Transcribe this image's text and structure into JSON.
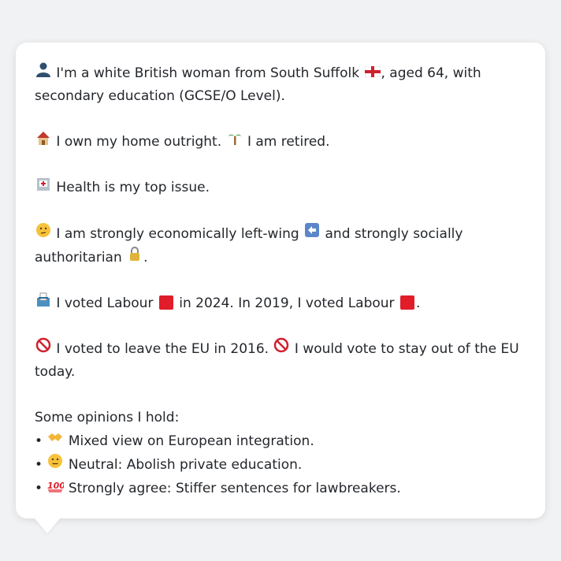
{
  "profile": {
    "identity": {
      "icon": "person-silhouette-icon",
      "text_a": "I'm a white British woman from South Suffolk",
      "flag": "england-flag-icon",
      "text_b": ", aged 64, with secondary education (GCSE/O Level)."
    },
    "home": {
      "house_icon": "house-icon",
      "text_a": "I own my home outright.",
      "palm_icon": "palm-tree-icon",
      "text_b": "I am retired."
    },
    "health": {
      "icon": "hospital-icon",
      "text": "Health is my top issue."
    },
    "ideology": {
      "icon": "thinking-face-icon",
      "text_a": "I am strongly economically left-wing",
      "left_icon": "left-arrow-icon",
      "text_b": "and strongly socially authoritarian",
      "lock_icon": "lock-icon",
      "text_c": "."
    },
    "votes": {
      "icon": "ballot-box-icon",
      "text_a": "I voted Labour",
      "text_b": "in 2024. In 2019, I voted Labour",
      "text_c": ".",
      "labour_color": "#e11d2a"
    },
    "eu": {
      "icon_1": "prohibited-icon",
      "text_a": "I voted to leave the EU in 2016.",
      "icon_2": "prohibited-icon",
      "text_b": "I would vote to stay out of the EU today."
    },
    "opinions": {
      "heading": "Some opinions I hold:",
      "items": [
        {
          "bullet": "•",
          "icon": "handshake-icon",
          "text": "Mixed view on European integration."
        },
        {
          "bullet": "•",
          "icon": "neutral-face-icon",
          "text": "Neutral: Abolish private education."
        },
        {
          "bullet": "•",
          "icon": "hundred-points-icon",
          "text": "Strongly agree: Stiffer sentences for lawbreakers."
        }
      ]
    }
  }
}
